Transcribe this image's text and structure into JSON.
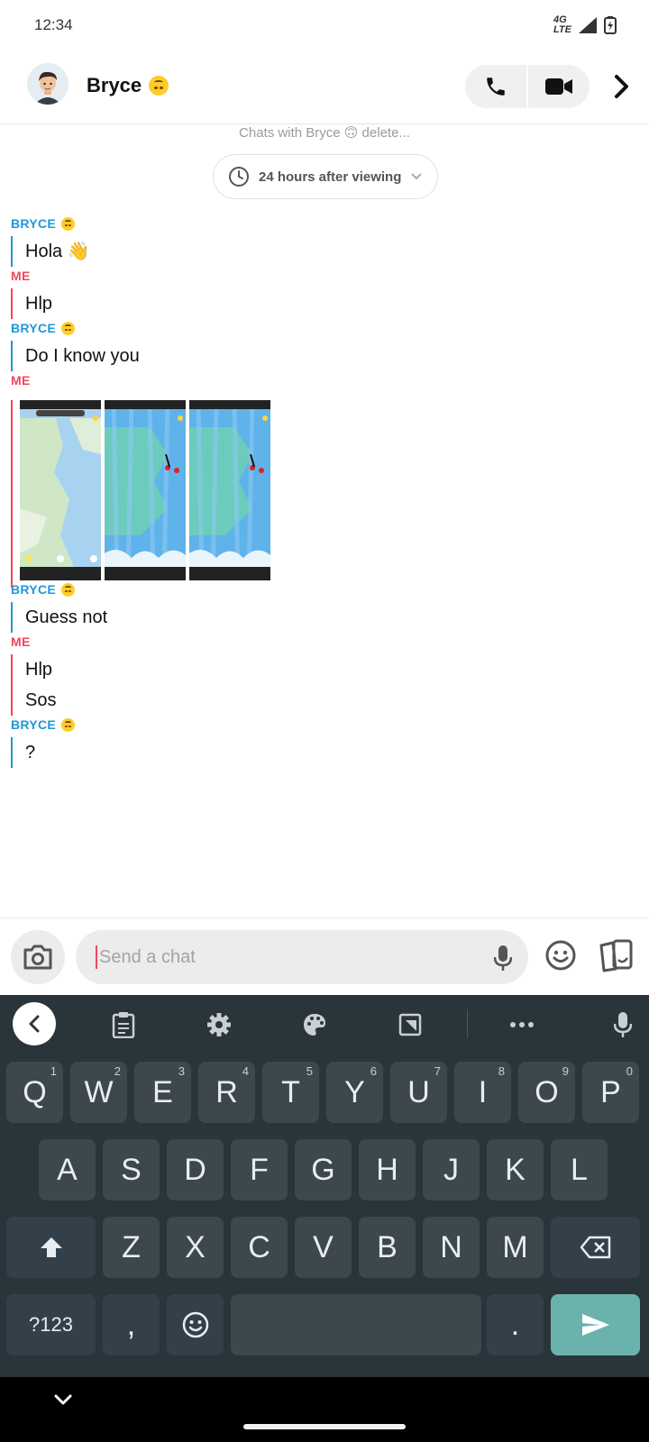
{
  "status": {
    "time": "12:34",
    "network": "4G LTE"
  },
  "header": {
    "name": "Bryce",
    "emoji": "upside-down-face-emoji"
  },
  "retention": {
    "note": "Chats with Bryce 🙃 delete...",
    "setting": "24 hours after viewing"
  },
  "messages": [
    {
      "sender": "BRYCE",
      "text": "Hola 👋"
    },
    {
      "sender": "ME",
      "text": "Hlp"
    },
    {
      "sender": "BRYCE",
      "text": "Do I know you"
    },
    {
      "sender": "ME",
      "media": "3 map screenshots"
    },
    {
      "sender": "BRYCE",
      "text": "Guess not"
    },
    {
      "sender": "ME",
      "text": "Hlp"
    },
    {
      "sender": "ME",
      "text": "Sos"
    },
    {
      "sender": "BRYCE",
      "text": "?"
    }
  ],
  "composer": {
    "placeholder": "Send a chat"
  },
  "keyboard": {
    "row1": [
      "Q",
      "W",
      "E",
      "R",
      "T",
      "Y",
      "U",
      "I",
      "O",
      "P"
    ],
    "row1_hints": [
      "1",
      "2",
      "3",
      "4",
      "5",
      "6",
      "7",
      "8",
      "9",
      "0"
    ],
    "row2": [
      "A",
      "S",
      "D",
      "F",
      "G",
      "H",
      "J",
      "K",
      "L"
    ],
    "row3": [
      "Z",
      "X",
      "C",
      "V",
      "B",
      "N",
      "M"
    ],
    "symbols": "?123",
    "comma": ",",
    "period": "."
  },
  "colors": {
    "bryce": "#1e98d9",
    "me": "#f0475e",
    "keyboard_bg": "#2a343b",
    "enter": "#6ab3ad"
  }
}
